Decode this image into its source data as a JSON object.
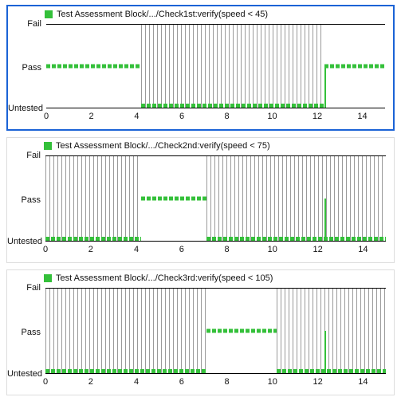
{
  "chart_data": [
    {
      "type": "line",
      "title": "Test Assessment Block/.../Check1st:verify(speed < 45)",
      "xlabel": "",
      "ylabel": "",
      "xlim": [
        0,
        15
      ],
      "y_categories": [
        "Fail",
        "Pass",
        "Untested"
      ],
      "x_ticks": [
        0,
        2,
        4,
        6,
        8,
        10,
        12,
        14
      ],
      "series": [
        {
          "name": "Check1st",
          "segments": [
            {
              "from": 0,
              "to": 4.2,
              "value": "Pass"
            },
            {
              "from": 4.2,
              "to": 12.3,
              "value": "Untested"
            },
            {
              "from": 12.3,
              "to": 15,
              "value": "Pass"
            }
          ],
          "transition_spikes": [
            12.3
          ]
        }
      ],
      "selected": true
    },
    {
      "type": "line",
      "title": "Test Assessment Block/.../Check2nd:verify(speed < 75)",
      "xlabel": "",
      "ylabel": "",
      "xlim": [
        0,
        15
      ],
      "y_categories": [
        "Fail",
        "Pass",
        "Untested"
      ],
      "x_ticks": [
        0,
        2,
        4,
        6,
        8,
        10,
        12,
        14
      ],
      "series": [
        {
          "name": "Check2nd",
          "segments": [
            {
              "from": 0,
              "to": 4.2,
              "value": "Untested"
            },
            {
              "from": 4.2,
              "to": 7.1,
              "value": "Pass"
            },
            {
              "from": 7.1,
              "to": 12.3,
              "value": "Untested"
            },
            {
              "from": 12.3,
              "to": 15,
              "value": "Untested"
            }
          ],
          "transition_spikes": [
            12.3
          ]
        }
      ],
      "selected": false
    },
    {
      "type": "line",
      "title": "Test Assessment Block/.../Check3rd:verify(speed < 105)",
      "xlabel": "",
      "ylabel": "",
      "xlim": [
        0,
        15
      ],
      "y_categories": [
        "Fail",
        "Pass",
        "Untested"
      ],
      "x_ticks": [
        0,
        2,
        4,
        6,
        8,
        10,
        12,
        14
      ],
      "series": [
        {
          "name": "Check3rd",
          "segments": [
            {
              "from": 0,
              "to": 7.1,
              "value": "Untested"
            },
            {
              "from": 7.1,
              "to": 10.2,
              "value": "Pass"
            },
            {
              "from": 10.2,
              "to": 12.3,
              "value": "Untested"
            },
            {
              "from": 12.3,
              "to": 15,
              "value": "Untested"
            }
          ],
          "transition_spikes": [
            12.3
          ]
        }
      ],
      "selected": false
    }
  ],
  "y_labels": {
    "fail": "Fail",
    "pass": "Pass",
    "untested": "Untested"
  },
  "colors": {
    "series": "#34c03a",
    "selection": "#1b63d6",
    "hatch": "#9a9a9a"
  }
}
